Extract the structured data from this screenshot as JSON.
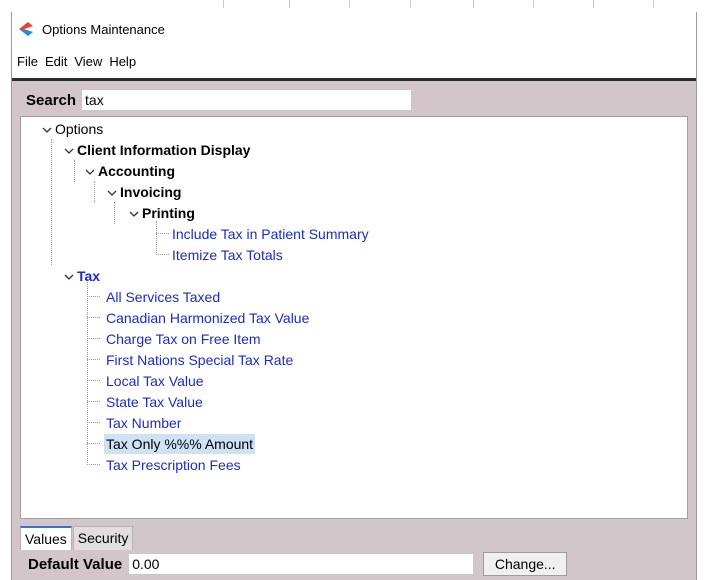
{
  "window": {
    "title": "Options Maintenance",
    "logo_icon": "app-logo-icon",
    "logo_colors": [
      "#e8412f",
      "#1d8fd6"
    ]
  },
  "menu": {
    "file": "File",
    "edit": "Edit",
    "view": "View",
    "help": "Help"
  },
  "search": {
    "label": "Search",
    "value": "tax"
  },
  "tree": {
    "root": "Options",
    "client_info": "Client Information Display",
    "accounting": "Accounting",
    "invoicing": "Invoicing",
    "printing": "Printing",
    "printing_items": [
      "Include Tax in Patient Summary",
      "Itemize Tax Totals"
    ],
    "tax": "Tax",
    "tax_items": [
      "All Services Taxed",
      "Canadian Harmonized Tax Value",
      "Charge Tax on Free Item",
      "First Nations Special Tax Rate",
      "Local Tax Value",
      "State Tax Value",
      "Tax Number",
      "Tax Only %%% Amount",
      "Tax Prescription Fees"
    ],
    "selected_item": "Tax Only %%% Amount"
  },
  "tabs": {
    "values": "Values",
    "security": "Security",
    "active": "Values"
  },
  "values": {
    "default_label": "Default Value",
    "default_value": "0.00",
    "change_button": "Change..."
  },
  "colors": {
    "panel_bg": "#d2c6cb",
    "link": "#1a2fb7",
    "selection": "#cfe2f3",
    "active_tab_accent": "#3b6fd1"
  }
}
